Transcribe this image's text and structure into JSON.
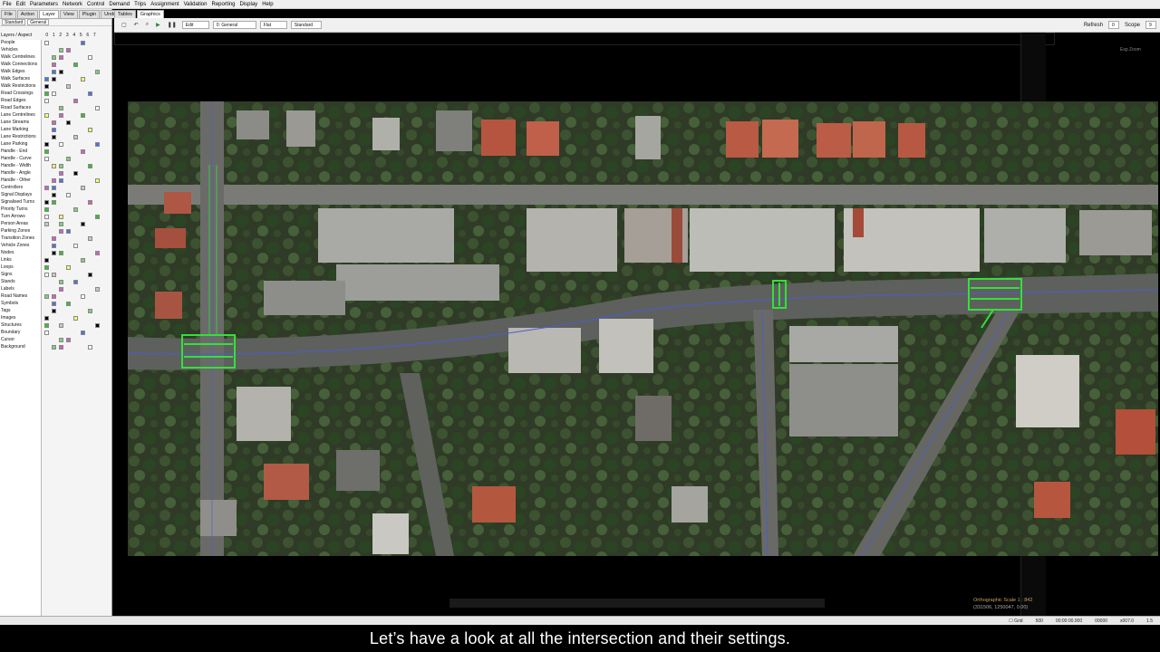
{
  "menu": [
    "File",
    "Edit",
    "Parameters",
    "Network",
    "Control",
    "Demand",
    "Trips",
    "Assignment",
    "Validation",
    "Reporting",
    "Display",
    "Help"
  ],
  "left_panel": {
    "tabs": [
      "File",
      "Action",
      "Layer",
      "View",
      "Plugin",
      "Undo"
    ],
    "active_tab": "Layer",
    "selects": [
      "Standard",
      "General"
    ],
    "column_header": [
      "0",
      "1",
      "2",
      "3",
      "4",
      "5",
      "6",
      "7"
    ],
    "layers_title": "Layers / Aspect",
    "layers": [
      "People",
      "Vehicles",
      "Walk Centrelines",
      "Walk Connections",
      "Walk Edges",
      "Walk Surfaces",
      "Walk Restrictions",
      "Road Crossings",
      "Road Edges",
      "Road Surfaces",
      "Lane Centrelines",
      "Lane Streams",
      "Lane Marking",
      "Lane Restrictions",
      "Lane Parking",
      "Handle - End",
      "Handle - Curve",
      "Handle - Width",
      "Handle - Angle",
      "Handle - Other",
      "Controllers",
      "Signal Displays",
      "Signalised Turns",
      "Priority Turns",
      "Turn Arrows",
      "Person Areas",
      "Parking Zones",
      "Transition Zones",
      "Vehicle Zones",
      "Nodes",
      "Links",
      "Loops",
      "Signs",
      "Stands",
      "Labels",
      "Road Names",
      "Symbols",
      "Tags",
      "Images",
      "Structures",
      "Boundary",
      "Cursor",
      "Background"
    ]
  },
  "view_tabs": [
    "Tables",
    "Graphics"
  ],
  "active_view_tab": "Graphics",
  "toolbar": {
    "edit": "Edit",
    "layer_select": "0: General",
    "mode_select": "Flat",
    "style_select": "Standard",
    "refresh_label": "Refresh",
    "refresh_value": "0",
    "scope_label": "Scope",
    "scope_value": "9"
  },
  "viewport": {
    "top_right": "Exp  Zoom",
    "projection": "Orthographic    Scale 1 : 842",
    "coords": "(331506, 1250047, 0.00)"
  },
  "statusbar": {
    "grid_label": "Grid",
    "grid_value": "500",
    "time": "00:00:00.000",
    "counter": "00000",
    "zoom": "x007.0",
    "speed": "1.5"
  },
  "subtitle": "Let’s have a look at all the intersection and their settings.",
  "colors": {
    "ui_bg": "#f0f0f0",
    "viewport_bg": "#000000",
    "junction_highlight": "#34e03a",
    "network_link": "#4a5cd0",
    "subtitle_text": "#ffffff"
  }
}
